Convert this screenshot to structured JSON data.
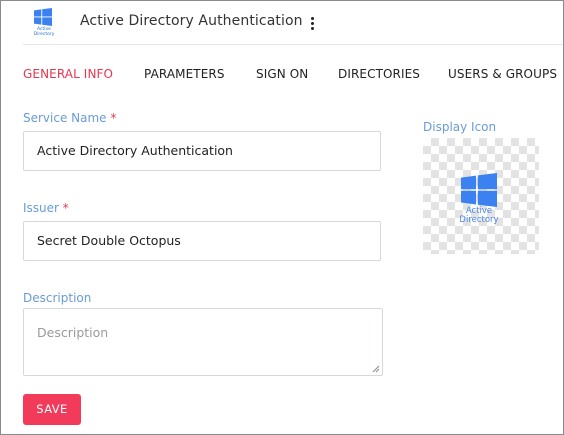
{
  "header": {
    "logo_text_line1": "Active",
    "logo_text_line2": "Directory",
    "title": "Active Directory Authentication"
  },
  "tabs": [
    {
      "label": "GENERAL INFO",
      "active": true
    },
    {
      "label": "PARAMETERS",
      "active": false
    },
    {
      "label": "SIGN ON",
      "active": false
    },
    {
      "label": "DIRECTORIES",
      "active": false
    },
    {
      "label": "USERS & GROUPS",
      "active": false
    }
  ],
  "form": {
    "service_name": {
      "label": "Service Name",
      "required_mark": "*",
      "value": "Active Directory Authentication"
    },
    "issuer": {
      "label": "Issuer",
      "required_mark": "*",
      "value": "Secret Double Octopus"
    },
    "description": {
      "label": "Description",
      "placeholder": "Description",
      "value": ""
    },
    "save_label": "SAVE"
  },
  "display_icon": {
    "label": "Display Icon",
    "text_line1": "Active",
    "text_line2": "Directory"
  },
  "colors": {
    "accent": "#e8364f",
    "save_button": "#f23a5b",
    "label": "#6a9bd8",
    "windows_logo": "#3b82f0"
  },
  "icons": {
    "app_logo": "windows-logo-icon",
    "menu": "kebab-menu-icon",
    "display_icon": "windows-logo-icon"
  }
}
